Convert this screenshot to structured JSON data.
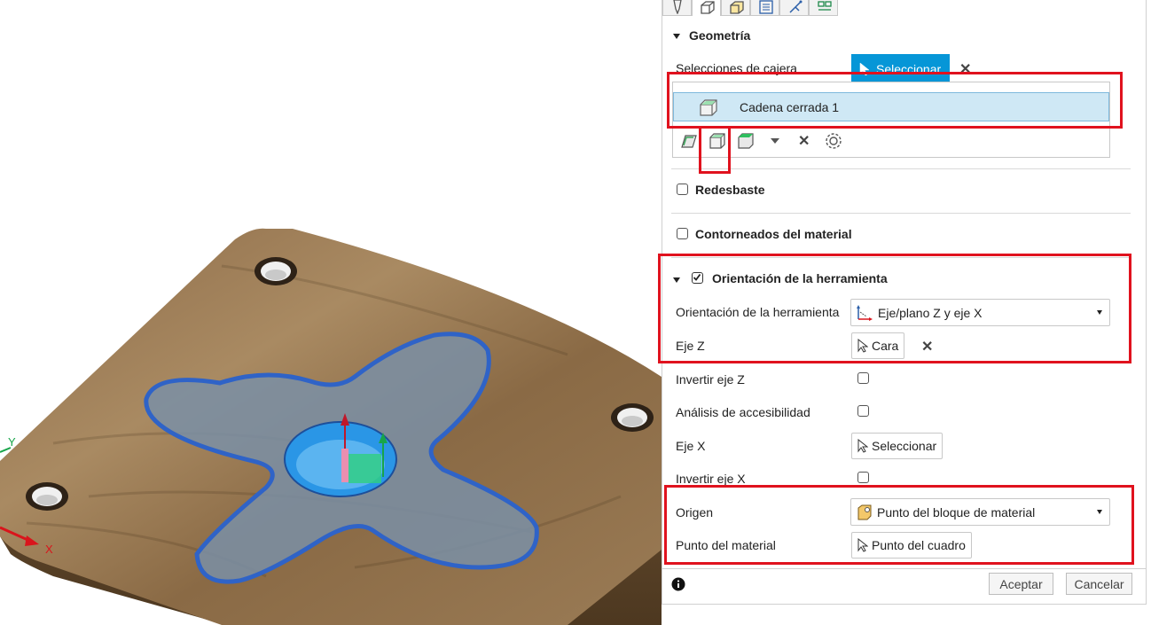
{
  "tabs": [
    {
      "icon": "tool-icon"
    },
    {
      "icon": "geometry-icon"
    },
    {
      "icon": "heights-icon"
    },
    {
      "icon": "passes-icon"
    },
    {
      "icon": "linking-icon"
    },
    {
      "icon": "shaft-holder-icon"
    }
  ],
  "geometry": {
    "title": "Geometría",
    "pocket_selections_label": "Selecciones de cajera",
    "select_button": "Seleccionar",
    "selection_item": "Cadena cerrada 1"
  },
  "rest_machining": {
    "label": "Redesbaste",
    "checked": false
  },
  "stock_contours": {
    "label": "Contorneados del material",
    "checked": false
  },
  "tool_orientation": {
    "title": "Orientación de la herramienta",
    "checked": true,
    "orientation_label": "Orientación de la herramienta",
    "orientation_value": "Eje/plano Z y eje X",
    "z_axis_label": "Eje Z",
    "z_axis_value": "Cara",
    "flip_z_label": "Invertir eje Z",
    "accessibility_label": "Análisis de accesibilidad",
    "x_axis_label": "Eje X",
    "x_axis_value": "Seleccionar",
    "flip_x_label": "Invertir eje X",
    "origin_label": "Origen",
    "origin_value": "Punto del bloque de material",
    "stock_point_label": "Punto del material",
    "stock_point_value": "Punto del cuadro"
  },
  "footer": {
    "ok": "Aceptar",
    "cancel": "Cancelar"
  },
  "viewport": {
    "axis_x": "X",
    "axis_y": "Y"
  },
  "colors": {
    "accent": "#0696d7",
    "highlight": "#e0121e",
    "selection_bg": "#cfe8f5"
  }
}
